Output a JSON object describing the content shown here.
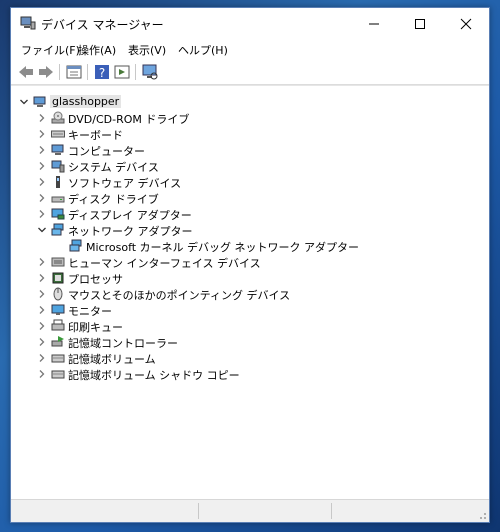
{
  "window": {
    "title": "デバイス マネージャー"
  },
  "menu": [
    "ファイル(F)",
    "操作(A)",
    "表示(V)",
    "ヘルプ(H)"
  ],
  "toolbar": {
    "icons": [
      "back-arrow-icon",
      "forward-arrow-icon",
      "properties-icon",
      "help-icon",
      "run-icon",
      "monitor-scan-icon"
    ]
  },
  "tree": {
    "root": "glasshopper",
    "items": [
      {
        "label": "DVD/CD-ROM ドライブ",
        "icon": "dvd-drive-icon",
        "expanded": false
      },
      {
        "label": "キーボード",
        "icon": "keyboard-icon",
        "expanded": false
      },
      {
        "label": "コンピューター",
        "icon": "computer-icon",
        "expanded": false
      },
      {
        "label": "システム デバイス",
        "icon": "system-device-icon",
        "expanded": false
      },
      {
        "label": "ソフトウェア デバイス",
        "icon": "software-device-icon",
        "expanded": false
      },
      {
        "label": "ディスク ドライブ",
        "icon": "disk-drive-icon",
        "expanded": false
      },
      {
        "label": "ディスプレイ アダプター",
        "icon": "display-adapter-icon",
        "expanded": false
      },
      {
        "label": "ネットワーク アダプター",
        "icon": "network-adapter-icon",
        "expanded": true,
        "children": [
          {
            "label": "Microsoft カーネル デバッグ ネットワーク アダプター",
            "icon": "network-adapter-icon"
          }
        ]
      },
      {
        "label": "ヒューマン インターフェイス デバイス",
        "icon": "hid-icon",
        "expanded": false
      },
      {
        "label": "プロセッサ",
        "icon": "processor-icon",
        "expanded": false
      },
      {
        "label": "マウスとそのほかのポインティング デバイス",
        "icon": "mouse-icon",
        "expanded": false
      },
      {
        "label": "モニター",
        "icon": "monitor-icon",
        "expanded": false
      },
      {
        "label": "印刷キュー",
        "icon": "printer-icon",
        "expanded": false
      },
      {
        "label": "記憶域コントローラー",
        "icon": "storage-controller-icon",
        "expanded": false
      },
      {
        "label": "記憶域ボリューム",
        "icon": "storage-volume-icon",
        "expanded": false
      },
      {
        "label": "記憶域ボリューム シャドウ コピー",
        "icon": "storage-volume-icon",
        "expanded": false
      }
    ]
  }
}
